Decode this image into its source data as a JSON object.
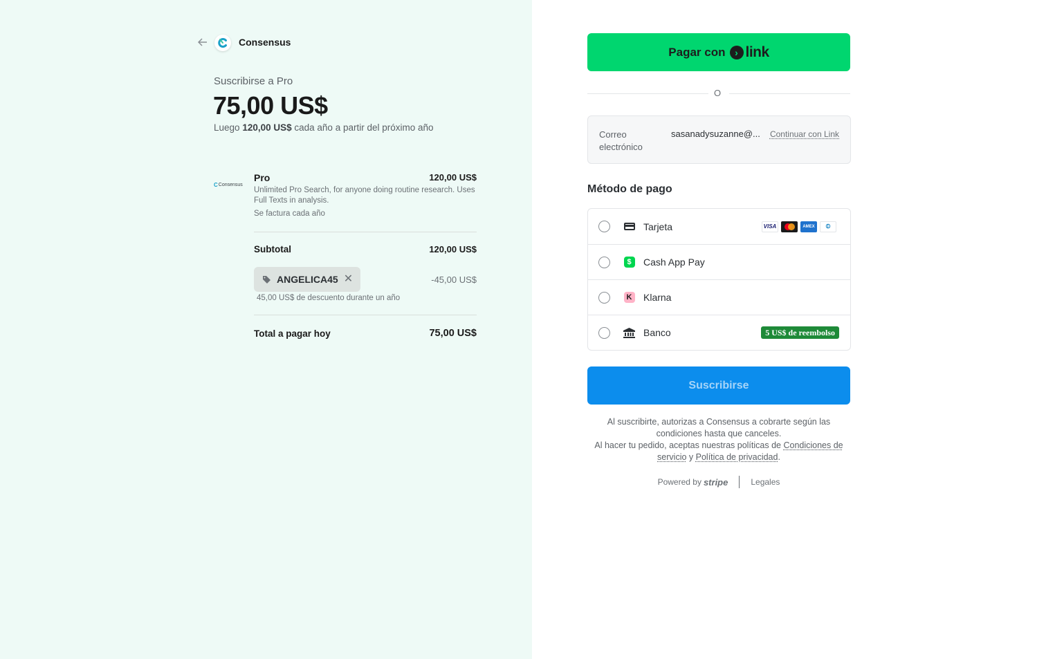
{
  "header": {
    "brand_name": "Consensus",
    "subscribe_title": "Suscribirse a Pro",
    "price": "75,00 US$",
    "then_prefix": "Luego",
    "then_amount": "120,00 US$",
    "then_suffix": "cada año a partir del próximo año"
  },
  "item": {
    "logo_text": "Consensus",
    "name": "Pro",
    "price": "120,00 US$",
    "description": "Unlimited Pro Search, for anyone doing routine research. Uses Full Texts in analysis.",
    "billing": "Se factura cada año"
  },
  "summary": {
    "subtotal_label": "Subtotal",
    "subtotal_value": "120,00 US$",
    "promo_code": "ANGELICA45",
    "discount_value": "-45,00 US$",
    "discount_note": "45,00 US$ de descuento durante un año",
    "total_label": "Total a pagar hoy",
    "total_value": "75,00 US$"
  },
  "link_button": {
    "label": "Pagar con",
    "logo_word": "link"
  },
  "or_text": "O",
  "email": {
    "label": "Correo electrónico",
    "value": "sasanadysuzanne@...",
    "link_label": "Continuar con Link"
  },
  "payment": {
    "title": "Método de pago",
    "methods": [
      {
        "label": "Tarjeta",
        "icon": "card-icon"
      },
      {
        "label": "Cash App Pay",
        "icon": "cash-app-icon"
      },
      {
        "label": "Klarna",
        "icon": "klarna-icon"
      },
      {
        "label": "Banco",
        "icon": "bank-icon",
        "badge": "5 US$ de reembolso"
      }
    ],
    "card_brands": [
      "VISA",
      "Mastercard",
      "AMEX",
      "Diners"
    ]
  },
  "subscribe_button": "Suscribirse",
  "legal": {
    "line1": "Al suscribirte, autorizas a Consensus a cobrarte según las condiciones hasta que canceles.",
    "line2_prefix": "Al hacer tu pedido, aceptas nuestras políticas de",
    "terms_link": "Condiciones de servicio",
    "and": "y",
    "privacy_link": "Política de privacidad",
    "end": "."
  },
  "footer": {
    "powered_by": "Powered by",
    "stripe": "stripe",
    "legal_link": "Legales"
  },
  "colors": {
    "left_bg": "#eefaf6",
    "link_green": "#00d66f",
    "subscribe_blue": "#0c8ded",
    "cashback_green": "#1e8a38"
  }
}
